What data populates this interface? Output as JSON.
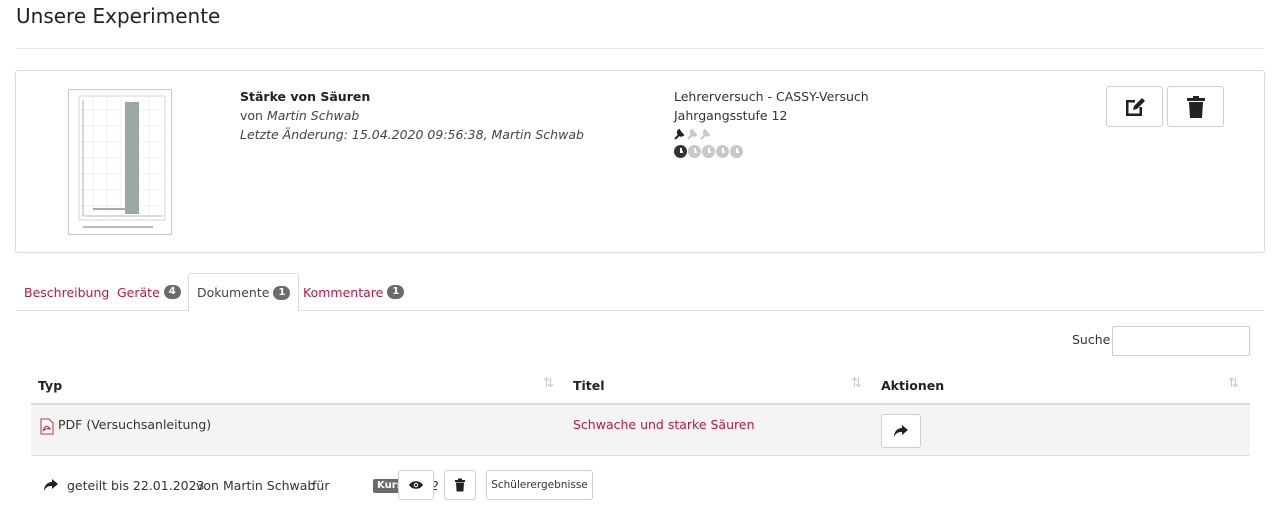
{
  "page": {
    "title": "Unsere Experimente"
  },
  "experiment": {
    "name": "Stärke von Säuren",
    "author_prefix": "von",
    "author": "Martin Schwab",
    "last_change": "Letzte Änderung: 15.04.2020 09:56:38, Martin Schwab",
    "type": "Lehrerversuch - CASSY-Versuch",
    "grade": "Jahrgangsstufe 12",
    "difficulty": {
      "icon": "wrench-icon",
      "value": 1,
      "max": 3
    },
    "duration": {
      "icon": "clock-icon",
      "value": 1,
      "max": 5
    }
  },
  "card_actions": {
    "edit": {
      "icon": "edit-icon"
    },
    "delete": {
      "icon": "trash-icon"
    }
  },
  "tabs": [
    {
      "label": "Beschreibung",
      "badge": ""
    },
    {
      "label": "Geräte",
      "badge": "4"
    },
    {
      "label": "Dokumente",
      "badge": "1"
    },
    {
      "label": "Kommentare",
      "badge": "1"
    }
  ],
  "active_tab": "Dokumente",
  "search": {
    "label": "Suche",
    "value": ""
  },
  "table": {
    "columns": [
      "Typ",
      "Titel",
      "Aktionen"
    ],
    "rows": [
      {
        "typ": "PDF (Versuchsanleitung)",
        "titel": "Schwache und starke Säuren",
        "action_icon": "share-icon"
      }
    ]
  },
  "share": {
    "shared_until": "geteilt bis 22.01.2023",
    "by": "von Martin Schwab",
    "for": "für",
    "kurs_label": "Kurs",
    "kurs_name": "Q12",
    "results_label": "Schülerergebnisse"
  },
  "colors": {
    "link": "#c0163d",
    "badge": "#6b6b6b"
  }
}
